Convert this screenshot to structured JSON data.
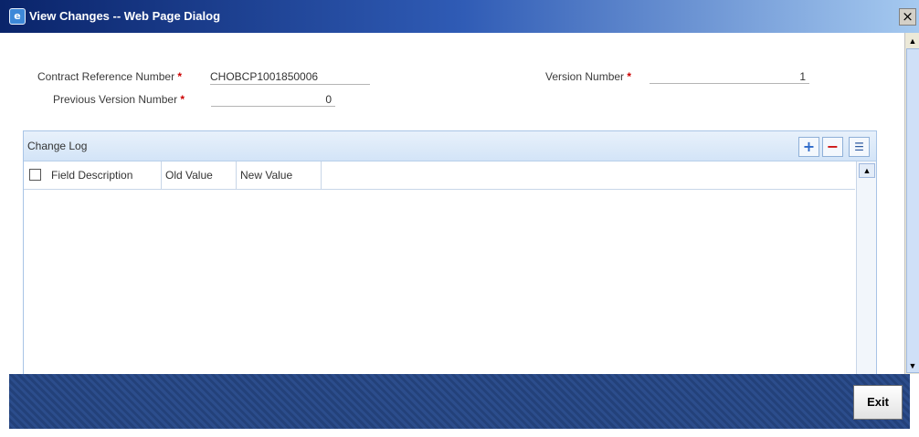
{
  "window": {
    "title": "View Changes -- Web Page Dialog",
    "close_label": "×"
  },
  "fields": {
    "contract_ref": {
      "label": "Contract Reference Number",
      "value": "CHOBCP1001850006"
    },
    "version": {
      "label": "Version Number",
      "value": "1"
    },
    "prev_version": {
      "label": "Previous Version Number",
      "value": "0"
    },
    "required_mark": "*"
  },
  "change_log": {
    "title": "Change Log",
    "columns": [
      "Field Description",
      "Old Value",
      "New Value"
    ],
    "rows": []
  },
  "buttons": {
    "exit": "Exit"
  },
  "colors": {
    "title_bar": "#0a246a",
    "footer": "#23417a",
    "panel_border": "#a8c4e6",
    "required": "#cc0000"
  }
}
